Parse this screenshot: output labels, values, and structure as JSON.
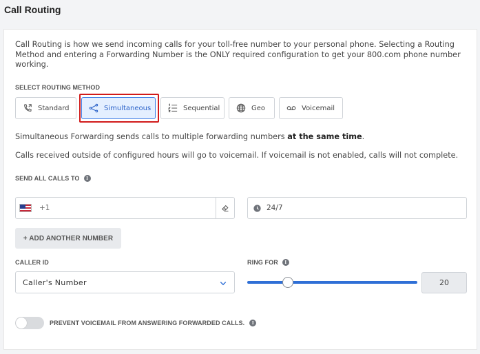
{
  "page": {
    "title": "Call Routing"
  },
  "intro_text": "Call Routing is how we send incoming calls for your toll-free number to your personal phone. Selecting a Routing Method and entering a Forwarding Number is the ONLY required configuration to get your 800.com phone number working.",
  "routing": {
    "label": "SELECT ROUTING METHOD",
    "selected": "Simultaneous",
    "methods": [
      {
        "label": "Standard",
        "icon": "phone-forward-icon"
      },
      {
        "label": "Simultaneous",
        "icon": "share-icon"
      },
      {
        "label": "Sequential",
        "icon": "ordered-list-icon"
      },
      {
        "label": "Geo",
        "icon": "globe-icon"
      },
      {
        "label": "Voicemail",
        "icon": "voicemail-icon"
      }
    ]
  },
  "description": {
    "prefix": "Simultaneous Forwarding sends calls to multiple forwarding numbers ",
    "bold": "at the same time",
    "suffix": "."
  },
  "hours_note": "Calls received outside of configured hours will go to voicemail. If voicemail is not enabled, calls will not complete.",
  "send_all": {
    "label": "SEND ALL CALLS TO",
    "info_glyph": "i",
    "country_code": "+1",
    "phone_value": "",
    "country_flag": "us-flag-icon",
    "hours_value": "24/7"
  },
  "add_number_label": "+ ADD ANOTHER NUMBER",
  "caller_id": {
    "label": "CALLER ID",
    "selected": "Caller's Number"
  },
  "ring_for": {
    "label": "RING FOR",
    "value": "20",
    "slider_fraction": 0.24
  },
  "prevent_voicemail": {
    "label": "PREVENT VOICEMAIL FROM ANSWERING FORWARDED CALLS.",
    "enabled": false
  },
  "colors": {
    "accent": "#2f6fd6",
    "active_bg": "#e4efff",
    "highlight": "#d11a1a"
  }
}
